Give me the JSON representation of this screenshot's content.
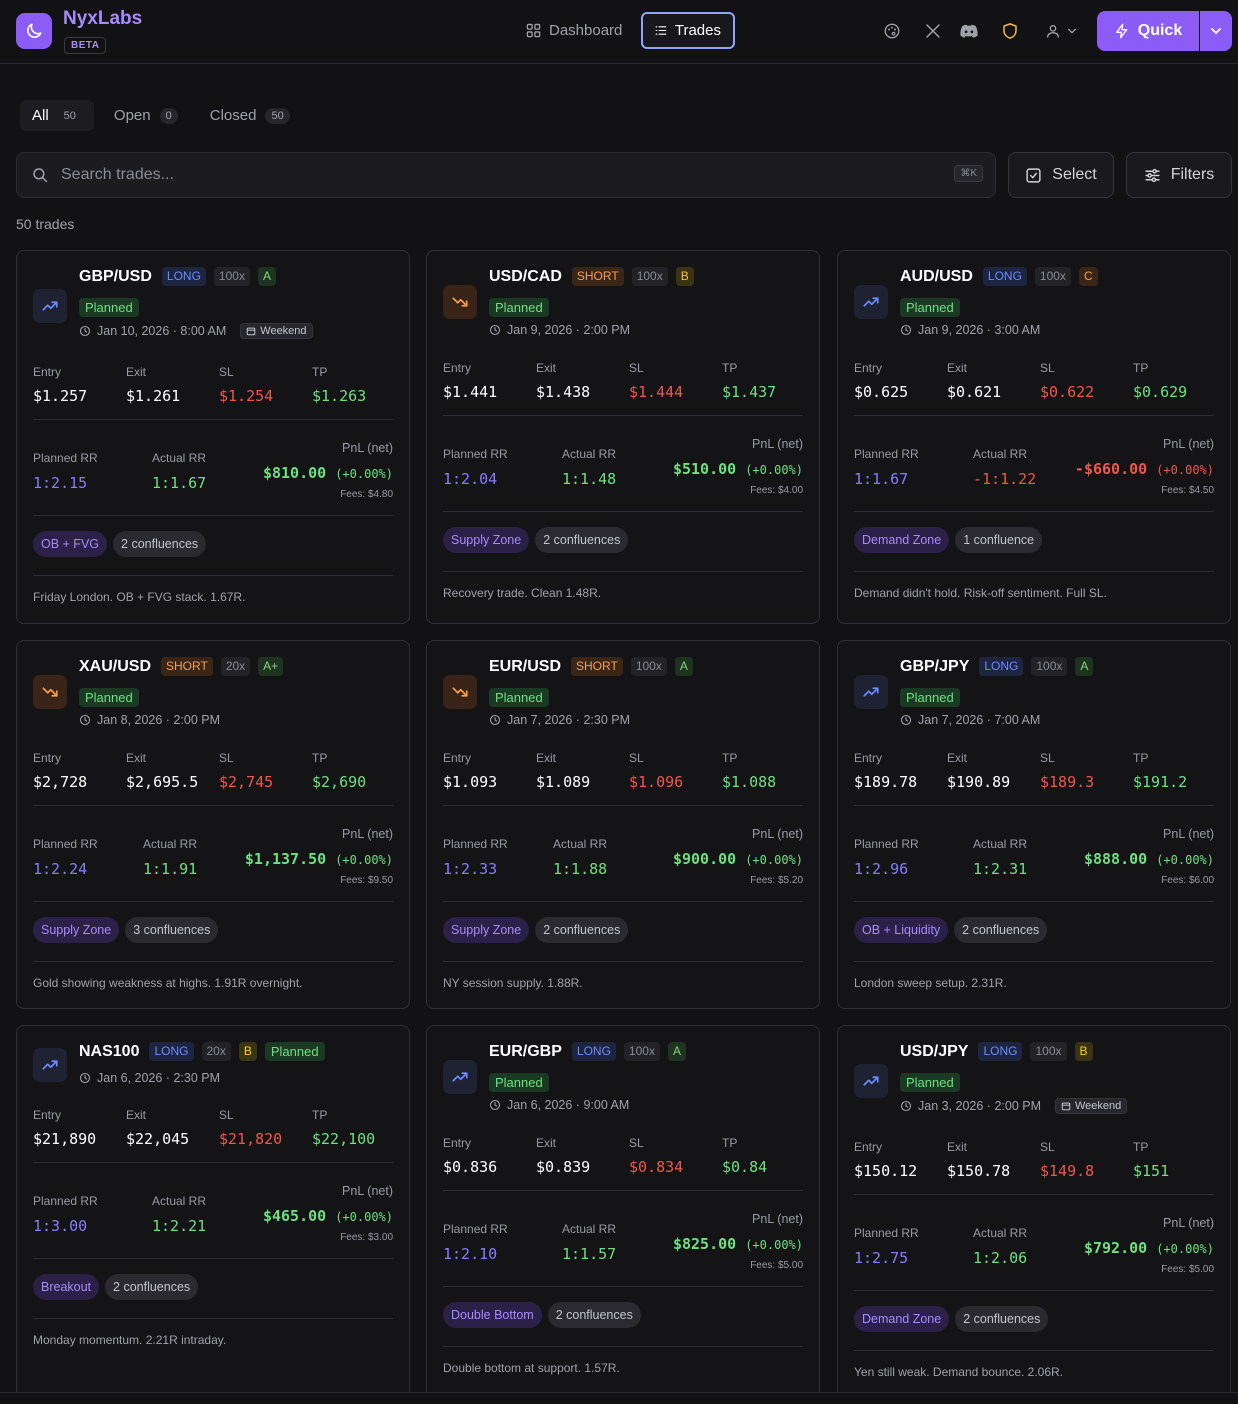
{
  "app": {
    "brand": "NyxLabs",
    "beta": "BETA"
  },
  "nav": {
    "dashboard": "Dashboard",
    "trades": "Trades"
  },
  "header": {
    "quick_label": "Quick"
  },
  "tabs": [
    {
      "label": "All",
      "count": "50"
    },
    {
      "label": "Open",
      "count": "0"
    },
    {
      "label": "Closed",
      "count": "50"
    }
  ],
  "search": {
    "placeholder": "Search trades...",
    "shortcut": "⌘K"
  },
  "toolbar": {
    "select_label": "Select",
    "filters_label": "Filters"
  },
  "trade_count": "50 trades",
  "labels": {
    "entry": "Entry",
    "exit": "Exit",
    "sl": "SL",
    "tp": "TP",
    "planned_rr": "Planned RR",
    "actual_rr": "Actual RR",
    "pnl": "PnL (net)"
  },
  "trades": [
    {
      "pair": "GBP/USD",
      "dir": "LONG",
      "lev": "100x",
      "grade": "A",
      "status": "Planned",
      "date": "Jan 10, 2026 · 8:00 AM",
      "weekend": "Weekend",
      "entry": "$1.257",
      "exit": "$1.261",
      "sl": "$1.254",
      "tp": "$1.263",
      "planned_rr": "1:2.15",
      "actual_rr": "1:1.67",
      "pnl": "$810.00",
      "pnl_pct": "(+0.00%)",
      "fees": "Fees: $4.80",
      "setup": "OB + FVG",
      "confluences": "2 confluences",
      "note": "Friday London. OB + FVG stack. 1.67R."
    },
    {
      "pair": "USD/CAD",
      "dir": "SHORT",
      "lev": "100x",
      "grade": "B",
      "status": "Planned",
      "date": "Jan 9, 2026 · 2:00 PM",
      "weekend": "",
      "entry": "$1.441",
      "exit": "$1.438",
      "sl": "$1.444",
      "tp": "$1.437",
      "planned_rr": "1:2.04",
      "actual_rr": "1:1.48",
      "pnl": "$510.00",
      "pnl_pct": "(+0.00%)",
      "fees": "Fees: $4.00",
      "setup": "Supply Zone",
      "confluences": "2 confluences",
      "note": "Recovery trade. Clean 1.48R."
    },
    {
      "pair": "AUD/USD",
      "dir": "LONG",
      "lev": "100x",
      "grade": "C",
      "status": "Planned",
      "date": "Jan 9, 2026 · 3:00 AM",
      "weekend": "",
      "entry": "$0.625",
      "exit": "$0.621",
      "sl": "$0.622",
      "tp": "$0.629",
      "planned_rr": "1:1.67",
      "actual_rr": "-1:1.22",
      "pnl": "-$660.00",
      "pnl_pct": "(+0.00%)",
      "fees": "Fees: $4.50",
      "setup": "Demand Zone",
      "confluences": "1 confluence",
      "note": "Demand didn't hold. Risk-off sentiment. Full SL."
    },
    {
      "pair": "XAU/USD",
      "dir": "SHORT",
      "lev": "20x",
      "grade": "A+",
      "status": "Planned",
      "date": "Jan 8, 2026 · 2:00 PM",
      "weekend": "",
      "entry": "$2,728",
      "exit": "$2,695.5",
      "sl": "$2,745",
      "tp": "$2,690",
      "planned_rr": "1:2.24",
      "actual_rr": "1:1.91",
      "pnl": "$1,137.50",
      "pnl_pct": "(+0.00%)",
      "fees": "Fees: $9.50",
      "setup": "Supply Zone",
      "confluences": "3 confluences",
      "note": "Gold showing weakness at highs. 1.91R overnight."
    },
    {
      "pair": "EUR/USD",
      "dir": "SHORT",
      "lev": "100x",
      "grade": "A",
      "status": "Planned",
      "date": "Jan 7, 2026 · 2:30 PM",
      "weekend": "",
      "entry": "$1.093",
      "exit": "$1.089",
      "sl": "$1.096",
      "tp": "$1.088",
      "planned_rr": "1:2.33",
      "actual_rr": "1:1.88",
      "pnl": "$900.00",
      "pnl_pct": "(+0.00%)",
      "fees": "Fees: $5.20",
      "setup": "Supply Zone",
      "confluences": "2 confluences",
      "note": "NY session supply. 1.88R."
    },
    {
      "pair": "GBP/JPY",
      "dir": "LONG",
      "lev": "100x",
      "grade": "A",
      "status": "Planned",
      "date": "Jan 7, 2026 · 7:00 AM",
      "weekend": "",
      "entry": "$189.78",
      "exit": "$190.89",
      "sl": "$189.3",
      "tp": "$191.2",
      "planned_rr": "1:2.96",
      "actual_rr": "1:2.31",
      "pnl": "$888.00",
      "pnl_pct": "(+0.00%)",
      "fees": "Fees: $6.00",
      "setup": "OB + Liquidity",
      "confluences": "2 confluences",
      "note": "London sweep setup. 2.31R."
    },
    {
      "pair": "NAS100",
      "dir": "LONG",
      "lev": "20x",
      "grade": "B",
      "status": "Planned",
      "date": "Jan 6, 2026 · 2:30 PM",
      "weekend": "",
      "entry": "$21,890",
      "exit": "$22,045",
      "sl": "$21,820",
      "tp": "$22,100",
      "planned_rr": "1:3.00",
      "actual_rr": "1:2.21",
      "pnl": "$465.00",
      "pnl_pct": "(+0.00%)",
      "fees": "Fees: $3.00",
      "setup": "Breakout",
      "confluences": "2 confluences",
      "note": "Monday momentum. 2.21R intraday."
    },
    {
      "pair": "EUR/GBP",
      "dir": "LONG",
      "lev": "100x",
      "grade": "A",
      "status": "Planned",
      "date": "Jan 6, 2026 · 9:00 AM",
      "weekend": "",
      "entry": "$0.836",
      "exit": "$0.839",
      "sl": "$0.834",
      "tp": "$0.84",
      "planned_rr": "1:2.10",
      "actual_rr": "1:1.57",
      "pnl": "$825.00",
      "pnl_pct": "(+0.00%)",
      "fees": "Fees: $5.00",
      "setup": "Double Bottom",
      "confluences": "2 confluences",
      "note": "Double bottom at support. 1.57R."
    },
    {
      "pair": "USD/JPY",
      "dir": "LONG",
      "lev": "100x",
      "grade": "B",
      "status": "Planned",
      "date": "Jan 3, 2026 · 2:00 PM",
      "weekend": "Weekend",
      "entry": "$150.12",
      "exit": "$150.78",
      "sl": "$149.8",
      "tp": "$151",
      "planned_rr": "1:2.75",
      "actual_rr": "1:2.06",
      "pnl": "$792.00",
      "pnl_pct": "(+0.00%)",
      "fees": "Fees: $5.00",
      "setup": "Demand Zone",
      "confluences": "2 confluences",
      "note": "Yen still weak. Demand bounce. 2.06R."
    }
  ]
}
